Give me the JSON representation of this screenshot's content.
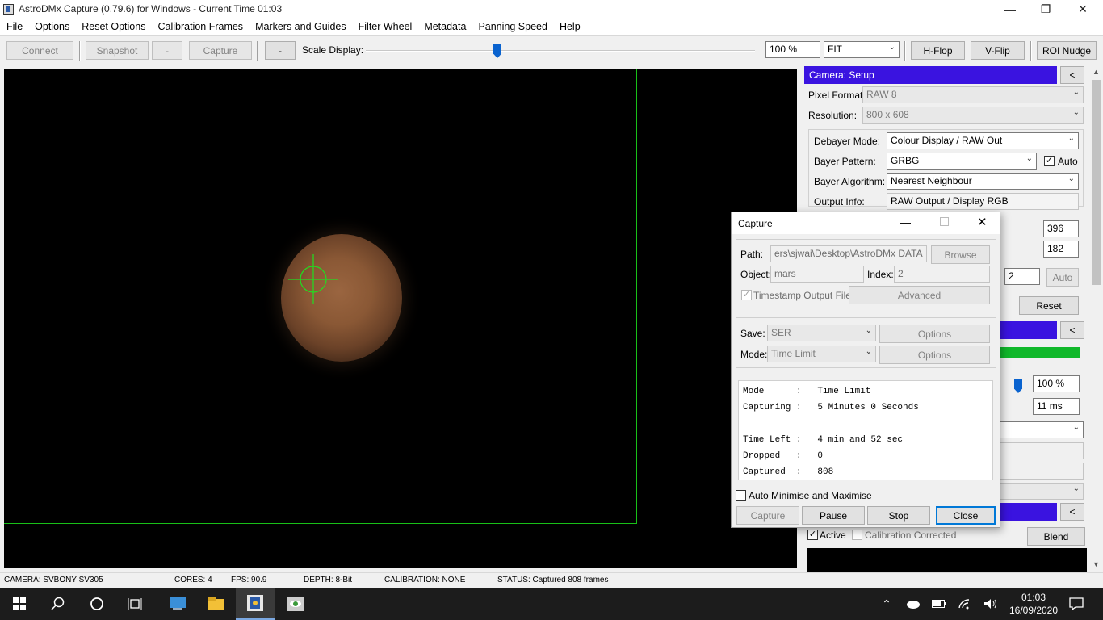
{
  "window": {
    "title": "AstroDMx Capture (0.79.6) for Windows - Current Time 01:03",
    "minimize": "—",
    "restore": "❐",
    "close": "✕"
  },
  "menu": [
    "File",
    "Options",
    "Reset Options",
    "Calibration Frames",
    "Markers and Guides",
    "Filter Wheel",
    "Metadata",
    "Panning Speed",
    "Help"
  ],
  "toolbar": {
    "connect": "Connect",
    "snapshot": "Snapshot",
    "dash1": "-",
    "capture": "Capture",
    "dash2": "-",
    "scale_label": "Scale Display:",
    "scale_value": "100 %",
    "scale_fraction": 0.35,
    "fit": "FIT",
    "hflop": "H-Flop",
    "vflip": "V-Flip",
    "roi": "ROI Nudge"
  },
  "panel": {
    "header": "Camera: Setup",
    "collapse": "<",
    "pixel_format_label": "Pixel Format:",
    "pixel_format": "RAW 8",
    "resolution_label": "Resolution:",
    "resolution": "800 x 608",
    "debayer_label": "Debayer Mode:",
    "debayer": "Colour Display / RAW Out",
    "bayer_pattern_label": "Bayer Pattern:",
    "bayer_pattern": "GRBG",
    "auto_label": "Auto",
    "bayer_algo_label": "Bayer Algorithm:",
    "bayer_algo": "Nearest Neighbour",
    "output_label": "Output Info:",
    "output": "RAW Output / Display RGB",
    "val_396": "396",
    "val_182": "182",
    "val_2": "2",
    "auto_btn": "Auto",
    "reset_btn": "Reset",
    "collapse2": "<",
    "gain_pct": "100 %",
    "exposure": "11 ms",
    "collapse3": "<",
    "active_label": "Active",
    "calib_label": "Calibration Corrected",
    "blend_btn": "Blend"
  },
  "dialog": {
    "title": "Capture",
    "path_label": "Path:",
    "path": "ers\\sjwai\\Desktop\\AstroDMx DATA",
    "browse": "Browse",
    "object_label": "Object:",
    "object": "mars",
    "index_label": "Index:",
    "index": "2",
    "timestamp_label": "Timestamp Output Files",
    "advanced": "Advanced",
    "save_label": "Save:",
    "save": "SER",
    "options1": "Options",
    "mode_label": "Mode:",
    "mode": "Time Limit",
    "options2": "Options",
    "info": [
      "Mode      :   Time Limit",
      "Capturing :   5 Minutes 0 Seconds",
      "",
      "Time Left :   4 min and 52 sec",
      "Dropped   :   0",
      "Captured  :   808"
    ],
    "auto_min_label": "Auto Minimise and Maximise",
    "capture_btn": "Capture",
    "pause_btn": "Pause",
    "stop_btn": "Stop",
    "close_btn": "Close"
  },
  "status": {
    "camera": "CAMERA: SVBONY SV305",
    "cores": "CORES: 4",
    "fps": "FPS: 90.9",
    "depth": "DEPTH: 8-Bit",
    "calibration": "CALIBRATION: NONE",
    "status": "STATUS: Captured 808 frames"
  },
  "taskbar": {
    "time": "01:03",
    "date": "16/09/2020"
  },
  "colors": {
    "section_header": "#3a13e0",
    "progress_green": "#10b82a",
    "roi_green": "#18c018"
  }
}
